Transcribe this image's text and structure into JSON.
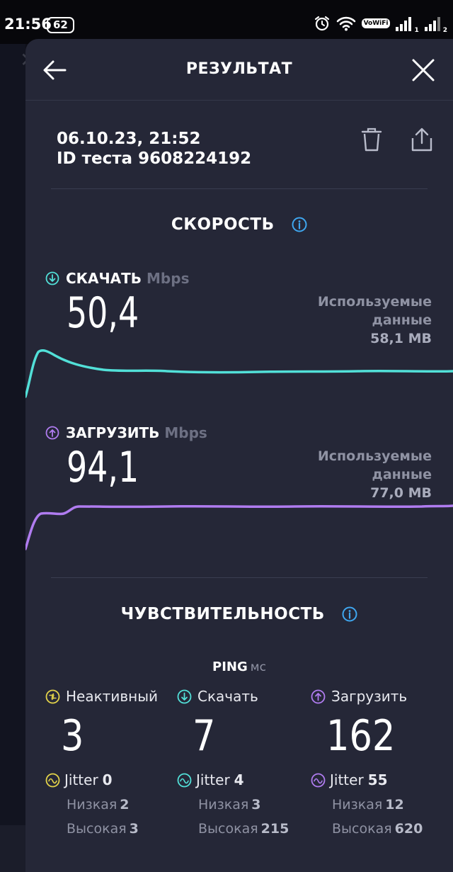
{
  "status_bar": {
    "time": "21:56",
    "badge": "62",
    "vowifi": "VoWiFi",
    "sim1": "1",
    "sim2": "2"
  },
  "header": {
    "title": "РЕЗУЛЬТАТ"
  },
  "test": {
    "datetime": "06.10.23, 21:52",
    "test_id": "ID теста 9608224192"
  },
  "speed": {
    "title": "СКОРОСТЬ",
    "download": {
      "label": "СКАЧАТЬ",
      "unit": "Mbps",
      "value": "50,4",
      "used_label_1": "Используемые",
      "used_label_2": "данные",
      "used_value": "58,1 MB",
      "color": "#52e0d8"
    },
    "upload": {
      "label": "ЗАГРУЗИТЬ",
      "unit": "Mbps",
      "value": "94,1",
      "used_label_1": "Используемые",
      "used_label_2": "данные",
      "used_value": "77,0 MB",
      "color": "#b07cf0"
    }
  },
  "responsiveness": {
    "title": "ЧУВСТВИТЕЛЬНОСТЬ",
    "ping_label": "PING",
    "ping_unit": "мс",
    "columns": [
      {
        "label": "Неактивный",
        "value": "3",
        "jitter_label": "Jitter",
        "jitter": "0",
        "low_label": "Низкая",
        "low": "2",
        "high_label": "Высокая",
        "high": "3",
        "color": "#e3d34a"
      },
      {
        "label": "Скачать",
        "value": "7",
        "jitter_label": "Jitter",
        "jitter": "4",
        "low_label": "Низкая",
        "low": "3",
        "high_label": "Высокая",
        "high": "215",
        "color": "#52e0d8"
      },
      {
        "label": "Загрузить",
        "value": "162",
        "jitter_label": "Jitter",
        "jitter": "55",
        "low_label": "Низкая",
        "low": "12",
        "high_label": "Высокая",
        "high": "620",
        "color": "#b07cf0"
      }
    ]
  }
}
